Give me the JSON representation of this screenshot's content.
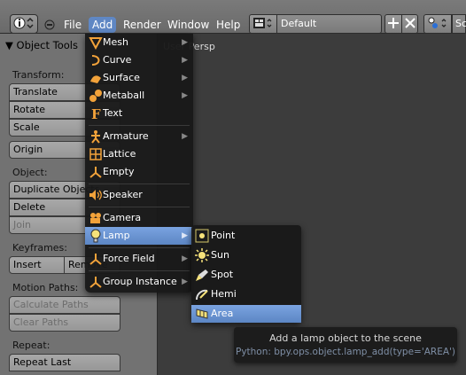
{
  "header": {
    "menus": [
      "File",
      "Add",
      "Render",
      "Window",
      "Help"
    ],
    "active_menu": "Add",
    "screen_layout": "Default",
    "scene_label": "Sc"
  },
  "viewport": {
    "label": "User Persp"
  },
  "tool_shelf": {
    "title": "Object Tools",
    "sections": {
      "transform": "Transform:",
      "object": "Object:",
      "keyframes": "Keyframes:",
      "motion_paths": "Motion Paths:",
      "repeat": "Repeat:"
    },
    "buttons": {
      "translate": "Translate",
      "rotate": "Rotate",
      "scale": "Scale",
      "origin": "Origin",
      "duplicate": "Duplicate Objects",
      "delete": "Delete",
      "join": "Join",
      "insert": "Insert",
      "remove": "Remove",
      "calculate_paths": "Calculate Paths",
      "clear_paths": "Clear Paths",
      "repeat_last": "Repeat Last"
    }
  },
  "add_menu": {
    "items": [
      "Mesh",
      "Curve",
      "Surface",
      "Metaball",
      "Text",
      "Armature",
      "Lattice",
      "Empty",
      "Speaker",
      "Camera",
      "Lamp",
      "Force Field",
      "Group Instance"
    ],
    "highlighted": "Lamp"
  },
  "lamp_submenu": {
    "items": [
      "Point",
      "Sun",
      "Spot",
      "Hemi",
      "Area"
    ],
    "highlighted": "Area"
  },
  "tooltip": {
    "description": "Add a lamp object to the scene",
    "python": "Python: bpy.ops.object.lamp_add(type='AREA')"
  },
  "colors": {
    "highlight": "#5f87c4",
    "menu_bg": "#191919",
    "shelf_bg": "#727272",
    "viewport_bg": "#3c3c3c",
    "icon_orange": "#f2a23a"
  },
  "icons": [
    "info-icon",
    "collapse-icon",
    "screen-layout-icon",
    "add-screen-icon",
    "delete-screen-icon",
    "scene-icon"
  ]
}
